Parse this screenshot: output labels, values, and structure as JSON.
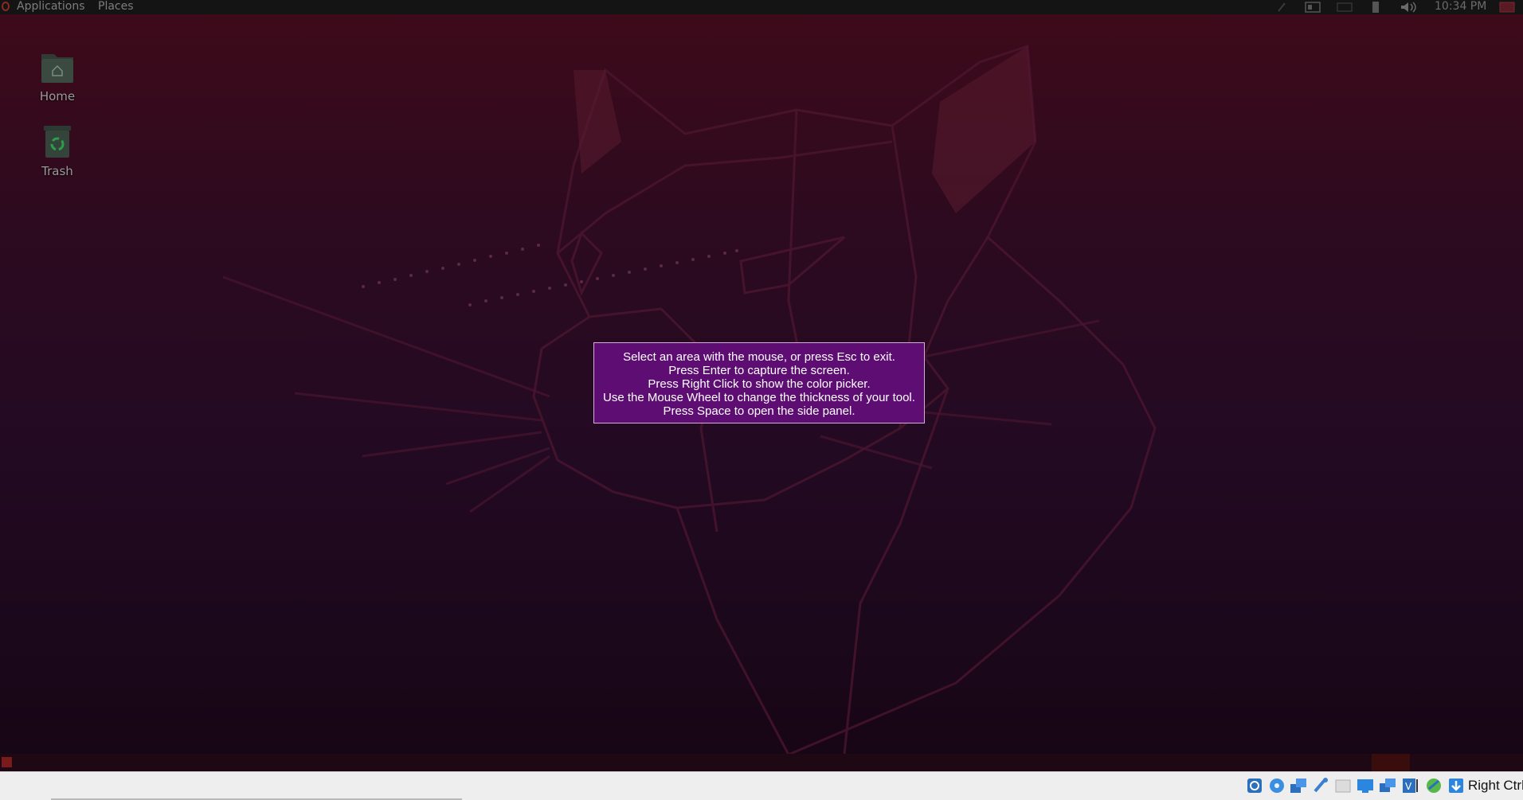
{
  "top_panel": {
    "applications_label": "Applications",
    "places_label": "Places",
    "clock": "10:34 PM"
  },
  "desktop": {
    "icons": [
      {
        "label": "Home",
        "icon": "home-folder-icon"
      },
      {
        "label": "Trash",
        "icon": "trash-icon"
      }
    ]
  },
  "screenshot_hint": {
    "lines": [
      "Select an area with the mouse, or press Esc to exit.",
      "Press Enter to capture the screen.",
      "Press Right Click to show the color picker.",
      "Use the Mouse Wheel to change the thickness of your tool.",
      "Press Space to open the side panel."
    ]
  },
  "vbox_status": {
    "host_key_label": "Right Ctrl",
    "icons": [
      "hard-disk-icon",
      "optical-drive-icon",
      "network-icon",
      "usb-icon",
      "shared-folders-icon",
      "display-icon",
      "video-capture-icon",
      "virtualization-icon",
      "mouse-integration-icon",
      "keyboard-capture-icon"
    ]
  },
  "colors": {
    "hint_background": "#5e0e73",
    "panel_background": "#141414",
    "wallpaper_top": "#3d0a1a",
    "wallpaper_bottom": "#170616"
  }
}
